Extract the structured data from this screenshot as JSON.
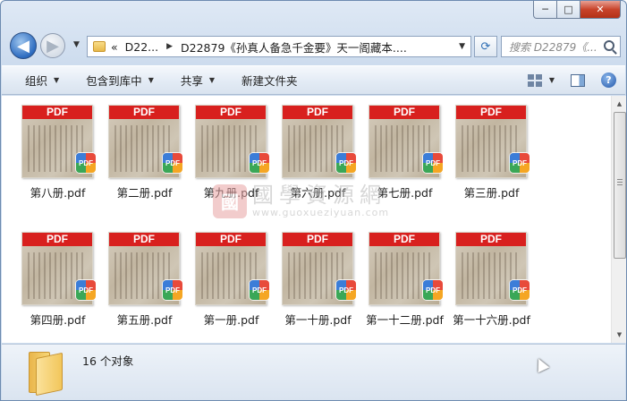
{
  "window": {
    "controls": {
      "minimize": "─",
      "maximize": "□",
      "close": "✕"
    }
  },
  "nav": {
    "back_icon": "◀",
    "forward_icon": "▶",
    "breadcrumb": [
      "«",
      "D22...",
      "D22879《孙真人备急千金要》天一阁藏本...."
    ],
    "search_placeholder": "搜索 D22879《...",
    "refresh_icon": "⟳"
  },
  "toolbar": {
    "organize": "组织",
    "include_in_library": "包含到库中",
    "share": "共享",
    "new_folder": "新建文件夹",
    "help": "?"
  },
  "files": [
    {
      "name": "第八册.pdf",
      "band": "PDF",
      "badge": "PDF"
    },
    {
      "name": "第二册.pdf",
      "band": "PDF",
      "badge": "PDF"
    },
    {
      "name": "第九册.pdf",
      "band": "PDF",
      "badge": "PDF"
    },
    {
      "name": "第六册.pdf",
      "band": "PDF",
      "badge": "PDF"
    },
    {
      "name": "第七册.pdf",
      "band": "PDF",
      "badge": "PDF"
    },
    {
      "name": "第三册.pdf",
      "band": "PDF",
      "badge": "PDF"
    },
    {
      "name": "第四册.pdf",
      "band": "PDF",
      "badge": "PDF"
    },
    {
      "name": "第五册.pdf",
      "band": "PDF",
      "badge": "PDF"
    },
    {
      "name": "第一册.pdf",
      "band": "PDF",
      "badge": "PDF"
    },
    {
      "name": "第一十册.pdf",
      "band": "PDF",
      "badge": "PDF"
    },
    {
      "name": "第一十二册.pdf",
      "band": "PDF",
      "badge": "PDF"
    },
    {
      "name": "第一十六册.pdf",
      "band": "PDF",
      "badge": "PDF"
    }
  ],
  "watermark": {
    "seal": "國",
    "main": "國學資源網",
    "url": "www.guoxueziyuan.com"
  },
  "status": {
    "count": "16 个对象"
  },
  "colors": {
    "pdf_band": "#d8201e",
    "window_frame": "#cddcee"
  }
}
